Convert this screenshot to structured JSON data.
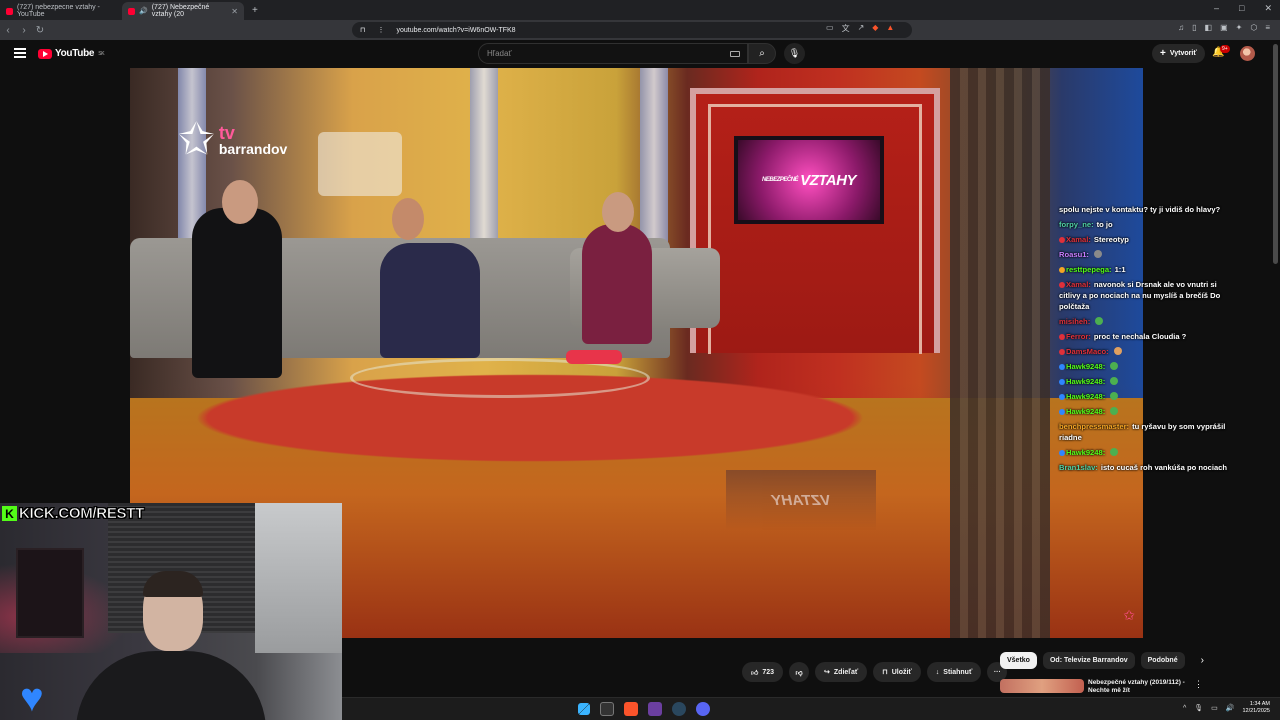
{
  "browser": {
    "tabs": [
      {
        "label": "(727) nebezpecne vztahy - YouTube",
        "active": false
      },
      {
        "label": "(727) Nebezpečné vztahy (20",
        "active": true
      }
    ],
    "new_tab_icon": "plus-icon",
    "url": "youtube.com/watch?v=iW6nOW-TFK8",
    "window_controls": [
      "–",
      "□",
      "✕"
    ]
  },
  "youtube": {
    "logo_text": "YouTube",
    "country_code": "SK",
    "search_placeholder": "Hľadať",
    "create_label": "Vytvoriť",
    "notification_count": "9+",
    "accent": "#ff0033"
  },
  "video": {
    "channel_logo_tv": "tv",
    "channel_logo_brand": "barrandov",
    "show_title_prefix": "NEBEZPEČNÉ",
    "show_title": "VZTAHY"
  },
  "chat": {
    "lines": [
      {
        "user": "",
        "color": "#ffffff",
        "text": "spolu nejste v kontaktu? ty ji vidiš do hlavy?",
        "badge": ""
      },
      {
        "user": "forpy_ne:",
        "color": "#4fd1a4",
        "text": "to jo",
        "badge": ""
      },
      {
        "user": "Xamal:",
        "color": "#e0303a",
        "text": "Stereotyp",
        "badge": "#e0303a"
      },
      {
        "user": "Roasu1:",
        "color": "#c77dff",
        "text": "",
        "badge": "",
        "emote": "#8a8a8a"
      },
      {
        "user": "resttpepega:",
        "color": "#53fc18",
        "text": "1:1",
        "badge": "#f5a524"
      },
      {
        "user": "Xamal:",
        "color": "#e0303a",
        "text": "navonok si Drsnak ale vo vnutri si citlivy a po nociach na nu myslíš a brečíš Do polčtaža",
        "badge": "#e0303a"
      },
      {
        "user": "misiheh:",
        "color": "#e0303a",
        "text": "",
        "badge": "",
        "emote": "#4caf50"
      },
      {
        "user": "Ferror:",
        "color": "#e0303a",
        "text": "proc te nechala Cloudia ?",
        "badge": "#e0303a"
      },
      {
        "user": "DamsMaco:",
        "color": "#e0303a",
        "text": "",
        "badge": "#e0303a",
        "emote": "#e0a060"
      },
      {
        "user": "Hawk9248:",
        "color": "#53fc18",
        "text": "",
        "badge": "#2f86ff",
        "emote": "#4caf50"
      },
      {
        "user": "Hawk9248:",
        "color": "#53fc18",
        "text": "",
        "badge": "#2f86ff",
        "emote": "#4caf50"
      },
      {
        "user": "Hawk9248:",
        "color": "#53fc18",
        "text": "",
        "badge": "#2f86ff",
        "emote": "#4caf50"
      },
      {
        "user": "Hawk9248:",
        "color": "#53fc18",
        "text": "",
        "badge": "#2f86ff",
        "emote": "#4caf50"
      },
      {
        "user": "benchpressmaster:",
        "color": "#f5a524",
        "text": "tu ryšavu by som vyprášil riadne",
        "badge": ""
      },
      {
        "user": "Hawk9248:",
        "color": "#53fc18",
        "text": "",
        "badge": "#2f86ff",
        "emote": "#4caf50"
      },
      {
        "user": "Bran1slav:",
        "color": "#4fd1a4",
        "text": "isto cucaš roh vankúša po nociach",
        "badge": ""
      }
    ]
  },
  "overlay": {
    "kick_letter": "K",
    "kick_text": "KICK.COM/RESTT"
  },
  "actions": {
    "like_count": "723",
    "share_label": "Zdieľať",
    "save_label": "Uložiť",
    "download_label": "Stiahnuť",
    "more_label": "···"
  },
  "filters": {
    "chips": [
      "Všetko",
      "Od: Televize Barrandov",
      "Podobné"
    ]
  },
  "recommended": {
    "title": "Nebezpečné vztahy (2019/112) - Nechte mě žít"
  },
  "taskbar": {
    "time": "1:34 AM",
    "date": "12/21/2025"
  }
}
